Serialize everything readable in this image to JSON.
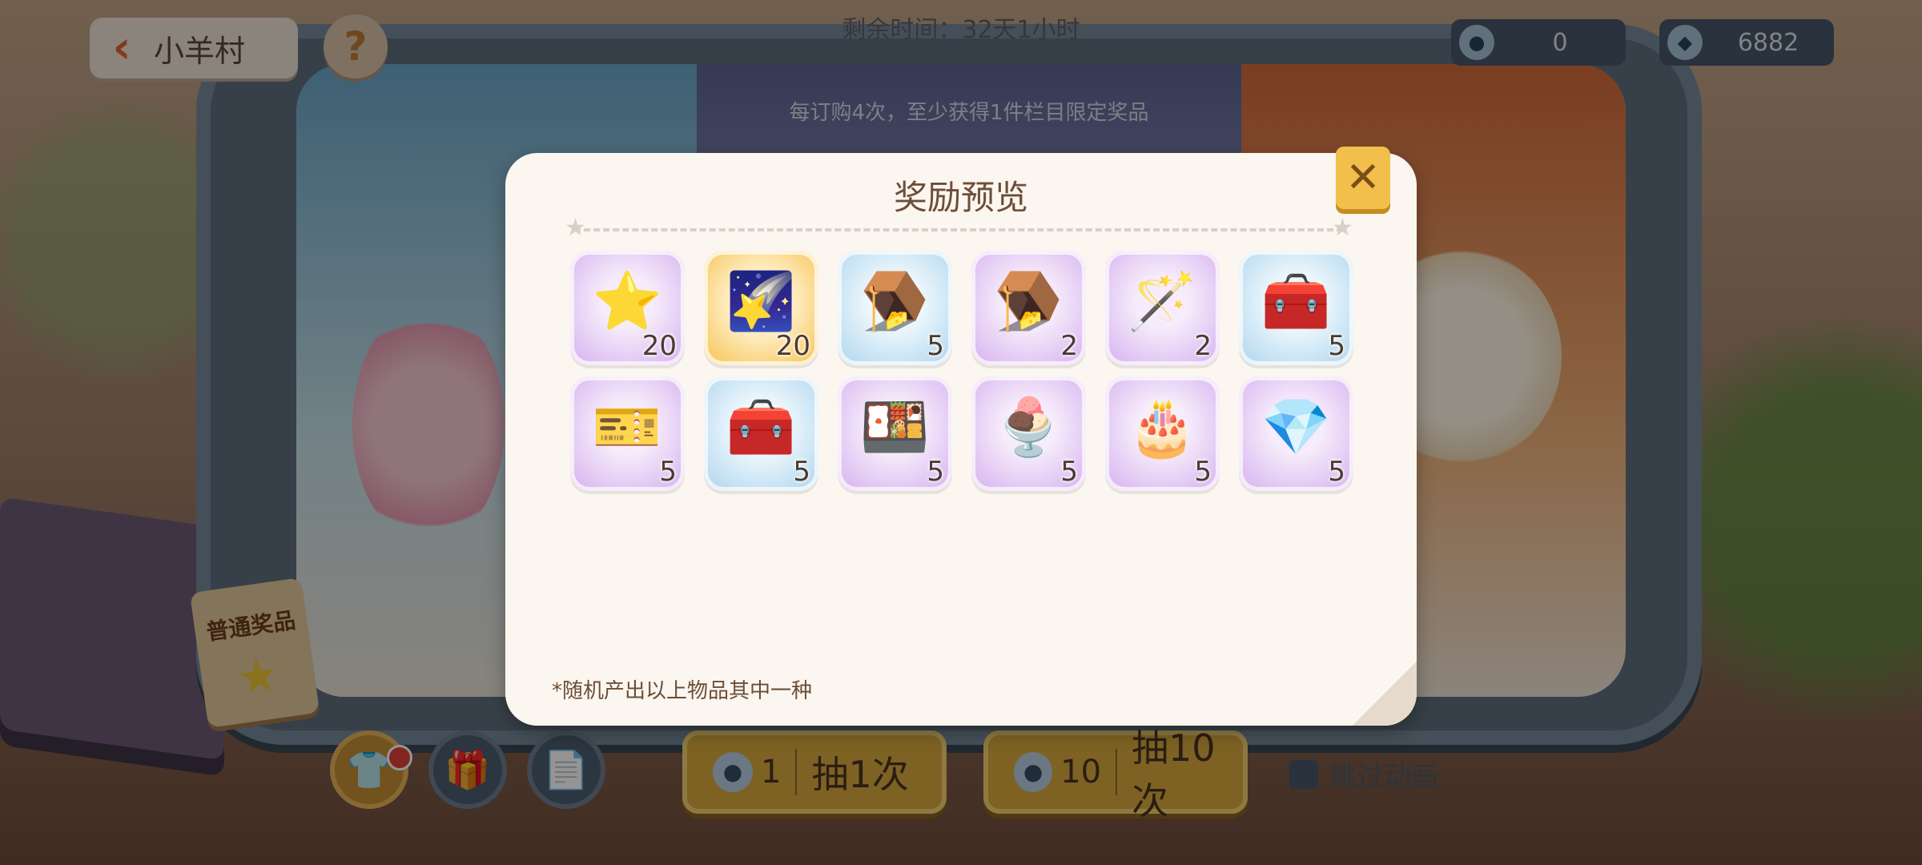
{
  "header": {
    "back_label": "小羊村",
    "help_label": "?",
    "timer": "剩余时间：32天1小时"
  },
  "currencies": [
    {
      "icon": "sheep-token-icon",
      "value": "0"
    },
    {
      "icon": "diamond-icon",
      "value": "6882"
    }
  ],
  "background": {
    "subtitle": "每订购4次，至少获得1件栏目限定奖品",
    "tag_label": "普通奖品"
  },
  "actions": {
    "draw1": {
      "cost": "1",
      "label": "抽1次"
    },
    "draw10": {
      "cost": "10",
      "label": "抽10次"
    },
    "skip_label": "跳过动画"
  },
  "modal": {
    "title": "奖励预览",
    "close": "✕",
    "note": "*随机产出以上物品其中一种",
    "items": [
      {
        "name": "gold-star",
        "glyph": "⭐",
        "count": "20",
        "rarity": "purple"
      },
      {
        "name": "rainbow-star",
        "glyph": "🌠",
        "count": "20",
        "rarity": "gold"
      },
      {
        "name": "mousetrap-copper",
        "glyph": "🪤",
        "count": "5",
        "rarity": "blue"
      },
      {
        "name": "mousetrap-dark",
        "glyph": "🪤",
        "count": "2",
        "rarity": "purple"
      },
      {
        "name": "magic-wand",
        "glyph": "🪄",
        "count": "2",
        "rarity": "purple"
      },
      {
        "name": "purple-chest",
        "glyph": "🧰",
        "count": "5",
        "rarity": "blue"
      },
      {
        "name": "ticket-card",
        "glyph": "🎫",
        "count": "5",
        "rarity": "purple"
      },
      {
        "name": "green-chest",
        "glyph": "🧰",
        "count": "5",
        "rarity": "blue"
      },
      {
        "name": "fruit-platter",
        "glyph": "🍱",
        "count": "5",
        "rarity": "purple"
      },
      {
        "name": "dessert-bowl",
        "glyph": "🍨",
        "count": "5",
        "rarity": "purple"
      },
      {
        "name": "tiered-dessert",
        "glyph": "🎂",
        "count": "5",
        "rarity": "purple"
      },
      {
        "name": "crystal-gift",
        "glyph": "💎",
        "count": "5",
        "rarity": "purple"
      }
    ]
  },
  "colors": {
    "accent": "#f2bf4a",
    "modal_bg": "#fbf6ef",
    "title_text": "#6c4e38"
  }
}
